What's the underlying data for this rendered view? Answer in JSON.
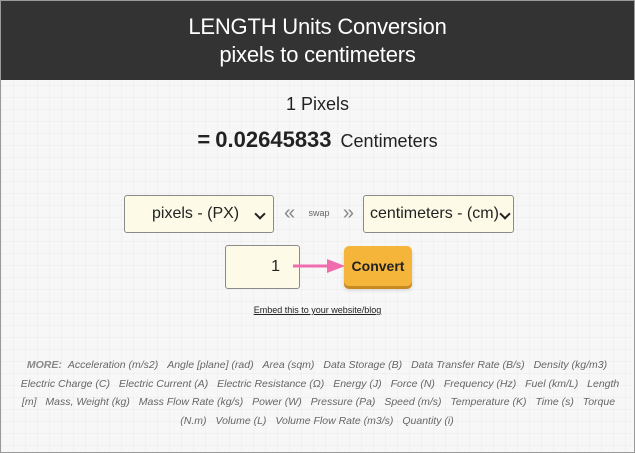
{
  "header": {
    "title_line1": "LENGTH Units Conversion",
    "title_line2": "pixels to centimeters"
  },
  "result": {
    "input_text": "1 Pixels",
    "equals": "=",
    "value": "0.02645833",
    "unit": "Centimeters"
  },
  "converter": {
    "from_unit": "pixels - (PX)",
    "to_unit": "centimeters - (cm)",
    "swap_label": "swap",
    "swap_left_glyph": "«",
    "swap_right_glyph": "»",
    "input_value": "1",
    "convert_label": "Convert"
  },
  "embed_link": "Embed this to your website/blog",
  "more": {
    "label": "MORE:",
    "items": [
      "Acceleration (m/s2)",
      "Angle [plane] (rad)",
      "Area (sqm)",
      "Data Storage (B)",
      "Data Transfer Rate (B/s)",
      "Density (kg/m3)",
      "Electric Charge (C)",
      "Electric Current (A)",
      "Electric Resistance (Ω)",
      "Energy (J)",
      "Force (N)",
      "Frequency (Hz)",
      "Fuel (km/L)",
      "Length [m]",
      "Mass, Weight (kg)",
      "Mass Flow Rate (kg/s)",
      "Power (W)",
      "Pressure (Pa)",
      "Speed (m/s)",
      "Temperature (K)",
      "Time (s)",
      "Torque (N.m)",
      "Volume (L)",
      "Volume Flow Rate (m3/s)",
      "Quantity (i)"
    ]
  },
  "colors": {
    "header_bg": "#333333",
    "convert_button": "#f5b53b",
    "pointer_arrow": "#f06cae",
    "field_bg": "#fdfbe8"
  },
  "icons": {
    "pointer": "pink-arrow-right-icon",
    "dropdown": "chevron-down-icon"
  }
}
